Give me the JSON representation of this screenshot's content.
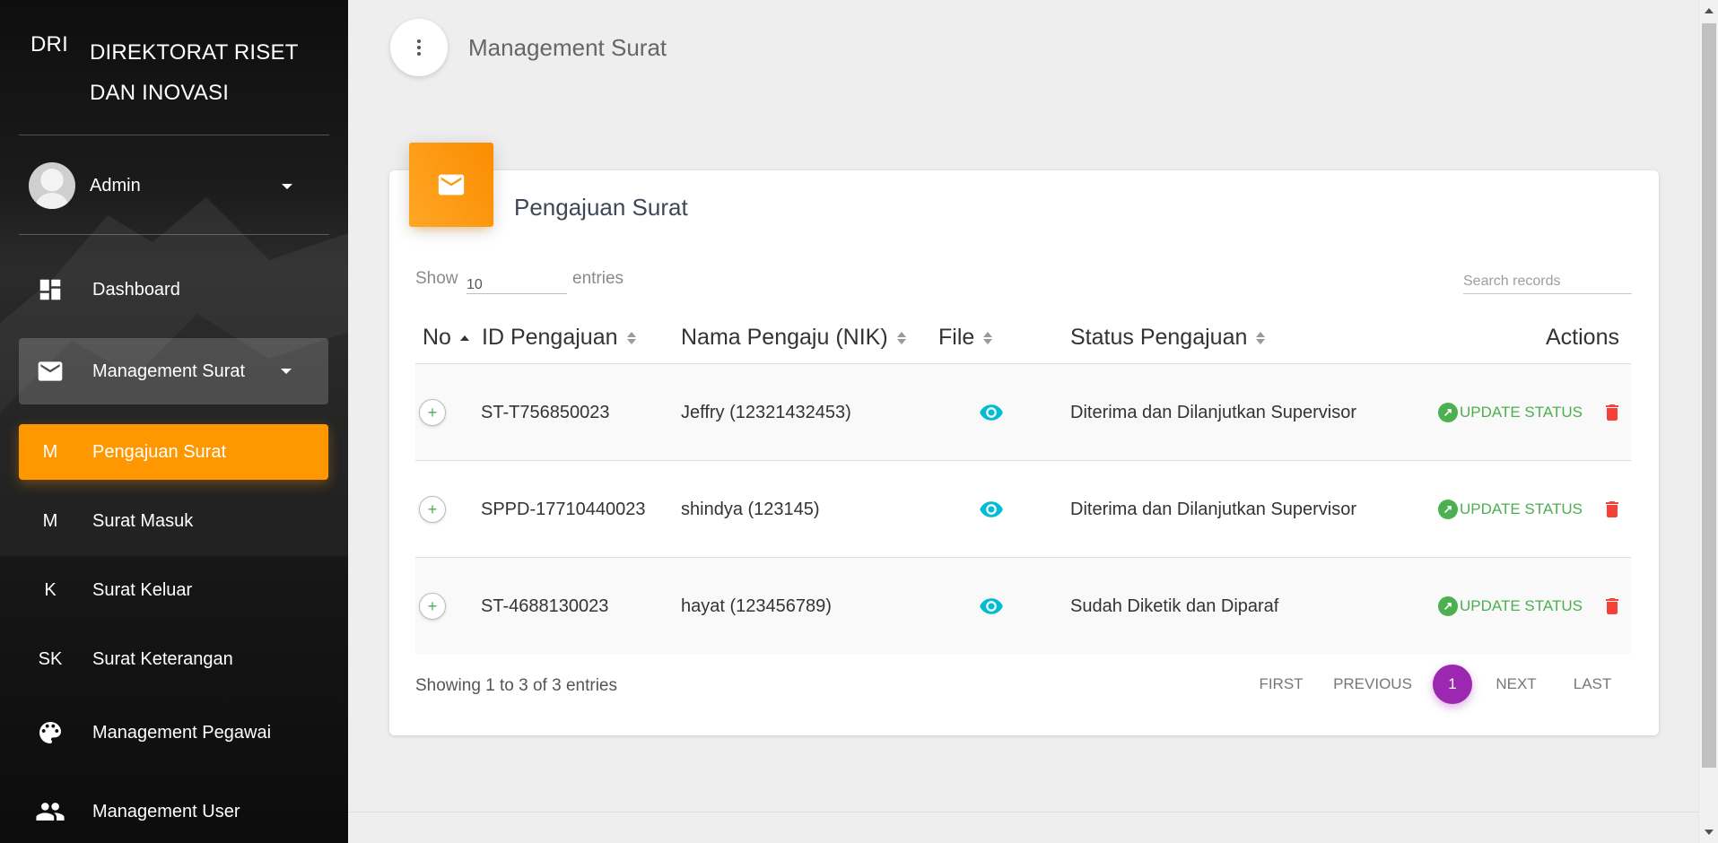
{
  "brand": {
    "mini": "DRI",
    "full": "DIREKTORAT RISET DAN INOVASI"
  },
  "user": {
    "name": "Admin"
  },
  "sidebar": {
    "items": [
      {
        "icon": "dashboard-icon",
        "label": "Dashboard"
      },
      {
        "icon": "mail-icon",
        "label": "Management Surat"
      },
      {
        "abbr": "M",
        "label": "Pengajuan Surat"
      },
      {
        "abbr": "M",
        "label": "Surat Masuk"
      },
      {
        "abbr": "K",
        "label": "Surat Keluar"
      },
      {
        "abbr": "SK",
        "label": "Surat Keterangan"
      },
      {
        "icon": "palette-icon",
        "label": "Management Pegawai"
      },
      {
        "icon": "people-icon",
        "label": "Management User"
      }
    ]
  },
  "header": {
    "title": "Management Surat"
  },
  "card": {
    "title": "Pengajuan Surat",
    "show_label": "Show",
    "entries_label": "entries",
    "page_length": "10",
    "search_placeholder": "Search records",
    "columns": [
      "No",
      "ID Pengajuan",
      "Nama Pengaju (NIK)",
      "File",
      "Status Pengajuan",
      "Actions"
    ],
    "rows": [
      {
        "id": "ST-T756850023",
        "name": "Jeffry (12321432453)",
        "status": "Diterima dan Dilanjutkan Supervisor",
        "action": "UPDATE STATUS"
      },
      {
        "id": "SPPD-17710440023",
        "name": "shindya (123145)",
        "status": "Diterima dan Dilanjutkan Supervisor",
        "action": "UPDATE STATUS"
      },
      {
        "id": "ST-4688130023",
        "name": "hayat (123456789)",
        "status": "Sudah Diketik dan Diparaf",
        "action": "UPDATE STATUS"
      }
    ],
    "info": "Showing 1 to 3 of 3 entries",
    "pagination": {
      "first": "First",
      "previous": "Previous",
      "current": "1",
      "next": "Next",
      "last": "Last"
    }
  },
  "colors": {
    "accent": "#ff9800",
    "success": "#4caf50",
    "danger": "#f44336",
    "info": "#00bcd4",
    "pagination": "#9c27b0"
  }
}
